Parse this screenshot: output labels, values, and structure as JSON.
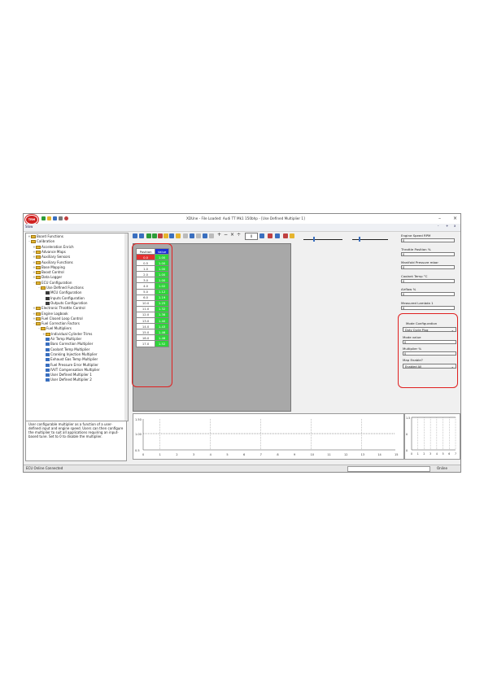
{
  "window": {
    "title": "XDUne - File Loaded:          Audi TT Mk1 150bhp - [Use Defined Multiplier 1]",
    "app_logo": "TRM"
  },
  "menubar": {
    "zoom_minus": "-",
    "zoom_plus": "+",
    "close": "x"
  },
  "tree": {
    "header": "Slow",
    "items": [
      {
        "label": "Board Functions",
        "level": 0,
        "type": "folder",
        "expander": "+"
      },
      {
        "label": "Calibration",
        "level": 0,
        "type": "folder",
        "expander": "-"
      },
      {
        "label": "Acceleration Enrich",
        "level": 1,
        "type": "folder",
        "expander": "+"
      },
      {
        "label": "Advance Maps",
        "level": 1,
        "type": "folder",
        "expander": "+"
      },
      {
        "label": "Auxiliary Sensors",
        "level": 1,
        "type": "folder",
        "expander": "+"
      },
      {
        "label": "Auxiliary Functions",
        "level": 1,
        "type": "folder",
        "expander": "+"
      },
      {
        "label": "Base Mapping",
        "level": 1,
        "type": "folder",
        "expander": "+"
      },
      {
        "label": "Boost Control",
        "level": 1,
        "type": "folder",
        "expander": "+"
      },
      {
        "label": "Data Logger",
        "level": 1,
        "type": "folder",
        "expander": "+"
      },
      {
        "label": "ECU Configuration",
        "level": 1,
        "type": "folder",
        "expander": "-"
      },
      {
        "label": "Use Defined Functions",
        "level": 2,
        "type": "folder",
        "expander": "-"
      },
      {
        "label": "MCU Configuration",
        "level": 3,
        "type": "grid",
        "expander": ""
      },
      {
        "label": "Inputs Configuration",
        "level": 3,
        "type": "grid",
        "expander": ""
      },
      {
        "label": "Outputs Configuration",
        "level": 3,
        "type": "grid",
        "expander": ""
      },
      {
        "label": "Electronic Throttle Control",
        "level": 1,
        "type": "folder",
        "expander": "+"
      },
      {
        "label": "Engine Logbook",
        "level": 1,
        "type": "folder",
        "expander": "+"
      },
      {
        "label": "Fuel Closed Loop Control",
        "level": 1,
        "type": "folder",
        "expander": "+"
      },
      {
        "label": "Fuel Correction Factors",
        "level": 1,
        "type": "folder",
        "expander": "-"
      },
      {
        "label": "Fuel Multipliers",
        "level": 2,
        "type": "folder",
        "expander": "-"
      },
      {
        "label": "Individual Cylinder Trims",
        "level": 3,
        "type": "folder",
        "expander": "+"
      },
      {
        "label": "Air Temp Multiplier",
        "level": 3,
        "type": "leaf",
        "expander": ""
      },
      {
        "label": "Baro Correction Multiplier",
        "level": 3,
        "type": "leaf",
        "expander": ""
      },
      {
        "label": "Coolant Temp Multiplier",
        "level": 3,
        "type": "leaf",
        "expander": ""
      },
      {
        "label": "Cranking Injection Multiplier",
        "level": 3,
        "type": "leaf",
        "expander": ""
      },
      {
        "label": "Exhaust Gas Temp Multiplier",
        "level": 3,
        "type": "leaf",
        "expander": ""
      },
      {
        "label": "Fuel Pressure Error Multiplier",
        "level": 3,
        "type": "leaf",
        "expander": ""
      },
      {
        "label": "IVVT Compensation Multiplier",
        "level": 3,
        "type": "leaf",
        "expander": ""
      },
      {
        "label": "User Defined Multiplier 1",
        "level": 3,
        "type": "leaf",
        "expander": ""
      },
      {
        "label": "User Defined Multiplier 2",
        "level": 3,
        "type": "leaf",
        "expander": ""
      }
    ]
  },
  "description": {
    "text": "User configurable multiplier as a function of a user-defined input and engine speed. Users can then configure the multiplier to suit all applications requiring an input-based tune. Set to 0 to disable the multiplier."
  },
  "toolbar": {
    "value_box": "0"
  },
  "table": {
    "header": [
      "Position",
      "Value"
    ],
    "header_colors": [
      "#ffffff",
      "#1b2fd6"
    ],
    "rows": [
      {
        "label": "0.0",
        "value": "1.00",
        "selected": true
      },
      {
        "label": "0.5",
        "value": "1.00"
      },
      {
        "label": "1.0",
        "value": "1.00"
      },
      {
        "label": "2.0",
        "value": "1.00"
      },
      {
        "label": "3.0",
        "value": "1.00"
      },
      {
        "label": "4.0",
        "value": "1.02"
      },
      {
        "label": "5.0",
        "value": "1.12"
      },
      {
        "label": "6.0",
        "value": "1.19"
      },
      {
        "label": "10.0",
        "value": "1.25"
      },
      {
        "label": "11.0",
        "value": "1.32"
      },
      {
        "label": "12.0",
        "value": "1.36"
      },
      {
        "label": "13.0",
        "value": "1.40"
      },
      {
        "label": "14.0",
        "value": "1.43"
      },
      {
        "label": "15.0",
        "value": "1.46"
      },
      {
        "label": "16.0",
        "value": "1.48"
      },
      {
        "label": "17.0",
        "value": "1.52"
      }
    ],
    "value_color": "#2fd43a",
    "selected_color": "#e53030"
  },
  "right_panel": {
    "fields": [
      {
        "label": "Engine Speed RPM",
        "value": "0"
      },
      {
        "label": "Throttle Position %",
        "value": "0"
      },
      {
        "label": "Manifold Pressure mbar",
        "value": "0"
      },
      {
        "label": "Coolant Temp °C",
        "value": "0"
      },
      {
        "label": "Airflow %",
        "value": "0"
      },
      {
        "label": "Measured Lambda 1",
        "value": "0"
      }
    ],
    "config": {
      "mode_label": "Mode Configuration",
      "mode_value": "Duty Cycle Plug",
      "mode_value_label": "Mode value",
      "mode_value_value": "0",
      "multiplier_label": "Multiplier %",
      "multiplier_value": "0",
      "map_enable_label": "Map Enable?",
      "map_enable_value": "Enabled All"
    }
  },
  "graph": {
    "y_top": "1.50",
    "y_mid": "1.00",
    "y_bottom": "0.5",
    "x_ticks": [
      "0",
      "1",
      "2",
      "3",
      "4",
      "5",
      "6",
      "7",
      "8",
      "9",
      "10",
      "11",
      "12",
      "13",
      "14",
      "15"
    ]
  },
  "mini_graph": {
    "y_top": "1.5",
    "y_mid": "0",
    "y_bottom": "0",
    "x_ticks": [
      "0",
      "1",
      "2",
      "3",
      "4",
      "5",
      "6",
      "7"
    ]
  },
  "status": {
    "left": "ECU Online   Connected",
    "right": "Online"
  }
}
